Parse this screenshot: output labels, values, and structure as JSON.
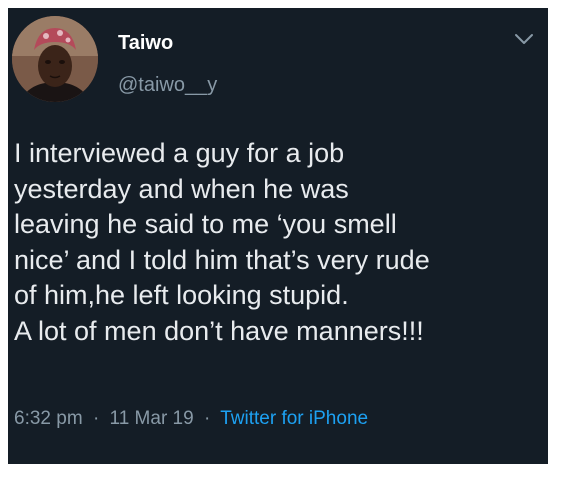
{
  "tweet": {
    "author": {
      "display_name": "Taiwo",
      "handle": "@taiwo__y",
      "avatar_icon": "profile-avatar"
    },
    "menu_icon": "chevron-down-icon",
    "text_lines": [
      "I interviewed a guy for a job",
      "yesterday and when he was",
      "leaving he said to me ‘you smell",
      "nice’ and I told him that’s very rude",
      "of him,he left looking stupid.",
      "A lot of men don’t have manners!!!"
    ],
    "time": "6:32 pm",
    "separator": "·",
    "date": "11 Mar 19",
    "source": "Twitter for iPhone"
  },
  "colors": {
    "background": "#141d26",
    "text": "#e8ebee",
    "muted": "#8899a6",
    "link": "#1da1f2"
  }
}
